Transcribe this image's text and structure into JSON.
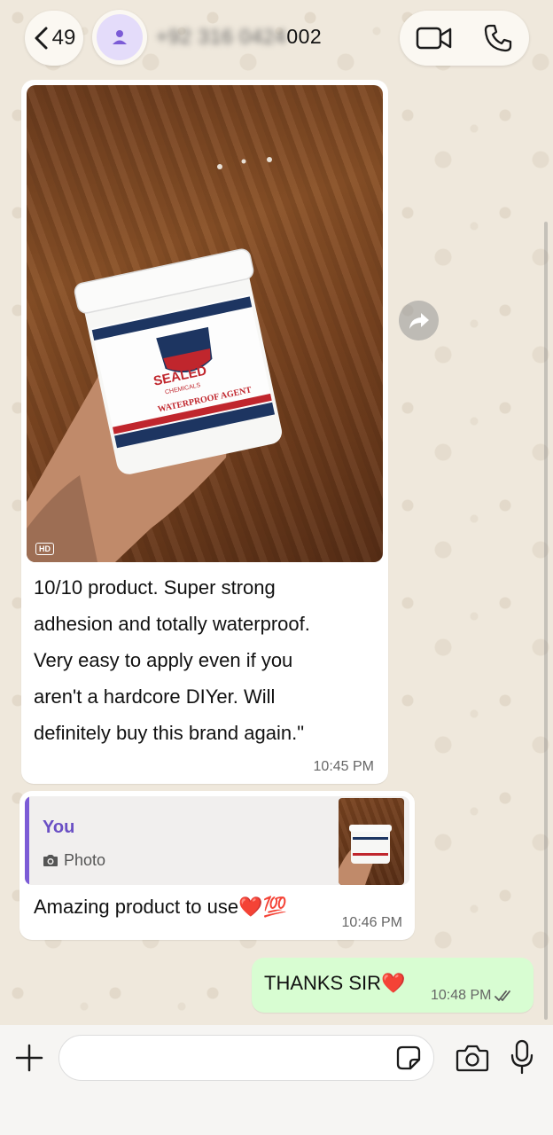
{
  "header": {
    "back_count": "49",
    "contact_name_blurred": "+92 316 0424",
    "contact_name_visible": "002"
  },
  "messages": [
    {
      "direction": "incoming",
      "type": "photo",
      "hd_badge": "HD",
      "photo_label_brand": "SEALED",
      "photo_label_sub": "CHEMICALS",
      "photo_label_product": "WATERPROOF AGENT",
      "text_lines": [
        "10/10 product. Super strong",
        "adhesion and totally waterproof.",
        "Very easy to apply even if you",
        "aren't a hardcore DIYer. Will",
        "definitely buy this brand again.\""
      ],
      "time": "10:45 PM"
    },
    {
      "direction": "incoming",
      "type": "reply",
      "quote_author": "You",
      "quote_type": "Photo",
      "text": "Amazing product to use❤️💯",
      "time": "10:46 PM"
    },
    {
      "direction": "outgoing",
      "type": "text",
      "text": "THANKS SIR❤️",
      "time": "10:48 PM",
      "status": "read"
    }
  ],
  "input": {
    "placeholder": ""
  },
  "colors": {
    "outgoing_bubble": "#d8fdd2",
    "incoming_bubble": "#ffffff",
    "quote_accent": "#7b5bd6",
    "read_ticks": "#5a5a5a"
  }
}
